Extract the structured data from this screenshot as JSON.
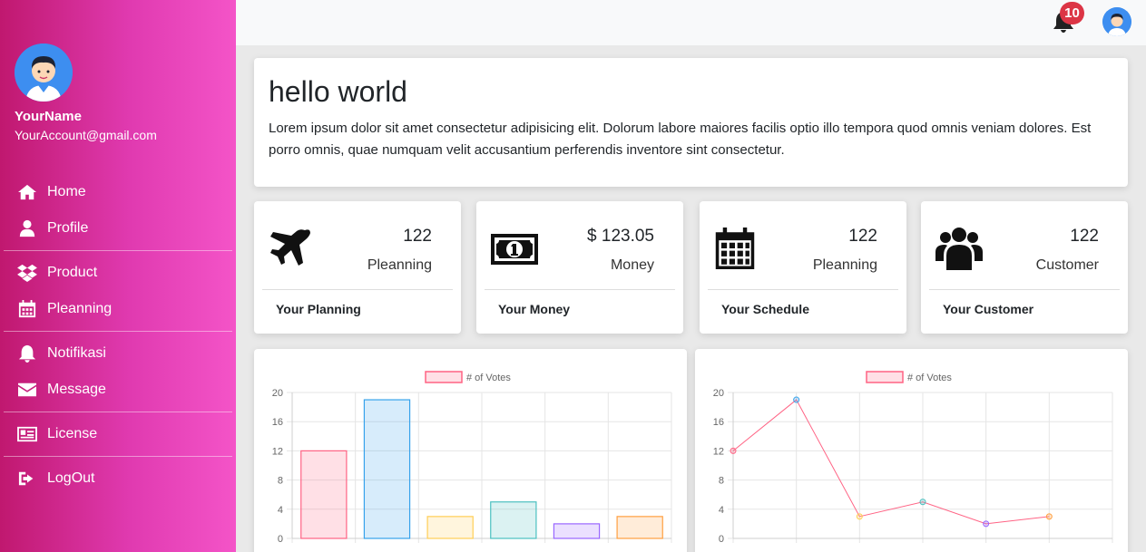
{
  "user": {
    "name": "YourName",
    "email": "YourAccount@gmail.com"
  },
  "nav": [
    {
      "label": "Home",
      "icon": "home-icon"
    },
    {
      "label": "Profile",
      "icon": "user-icon"
    },
    {
      "label": "Product",
      "icon": "dropbox-icon"
    },
    {
      "label": "Pleanning",
      "icon": "calendar-icon"
    },
    {
      "label": "Notifikasi",
      "icon": "bell-icon"
    },
    {
      "label": "Message",
      "icon": "envelope-icon"
    },
    {
      "label": "License",
      "icon": "id-card-icon"
    },
    {
      "label": "LogOut",
      "icon": "sign-out-icon"
    }
  ],
  "topbar": {
    "notification_count": "10"
  },
  "hello": {
    "title": "hello world",
    "text": "Lorem ipsum dolor sit amet consectetur adipisicing elit. Dolorum labore maiores facilis optio illo tempora quod omnis veniam dolores. Est porro omnis, quae numquam velit accusantium perferendis inventore sint consectetur."
  },
  "stats": [
    {
      "value": "122",
      "label": "Pleanning",
      "footer": "Your Planning",
      "icon": "plane-icon"
    },
    {
      "value": "$ 123.05",
      "label": "Money",
      "footer": "Your Money",
      "icon": "money-icon"
    },
    {
      "value": "122",
      "label": "Pleanning",
      "footer": "Your Schedule",
      "icon": "calendar-icon"
    },
    {
      "value": "122",
      "label": "Customer",
      "footer": "Your Customer",
      "icon": "users-icon"
    }
  ],
  "chart_data": [
    {
      "type": "bar",
      "series": [
        {
          "name": "# of Votes",
          "values": [
            12,
            19,
            3,
            5,
            2,
            3
          ]
        }
      ],
      "ylim": [
        0,
        20
      ],
      "yticks": [
        0,
        4,
        8,
        12,
        16,
        20
      ],
      "colors": [
        "#ff6384",
        "#36a2eb",
        "#ffce56",
        "#4bc0c0",
        "#9966ff",
        "#ff9f40"
      ],
      "grid": true,
      "legend": "top"
    },
    {
      "type": "line",
      "series": [
        {
          "name": "# of Votes",
          "values": [
            12,
            19,
            3,
            5,
            2,
            3
          ]
        }
      ],
      "ylim": [
        0,
        20
      ],
      "yticks": [
        0,
        4,
        8,
        12,
        16,
        20
      ],
      "line_color": "#ff6384",
      "point_colors": [
        "#ff6384",
        "#36a2eb",
        "#ffce56",
        "#4bc0c0",
        "#9966ff",
        "#ff9f40"
      ],
      "grid": true,
      "legend": "top"
    }
  ]
}
